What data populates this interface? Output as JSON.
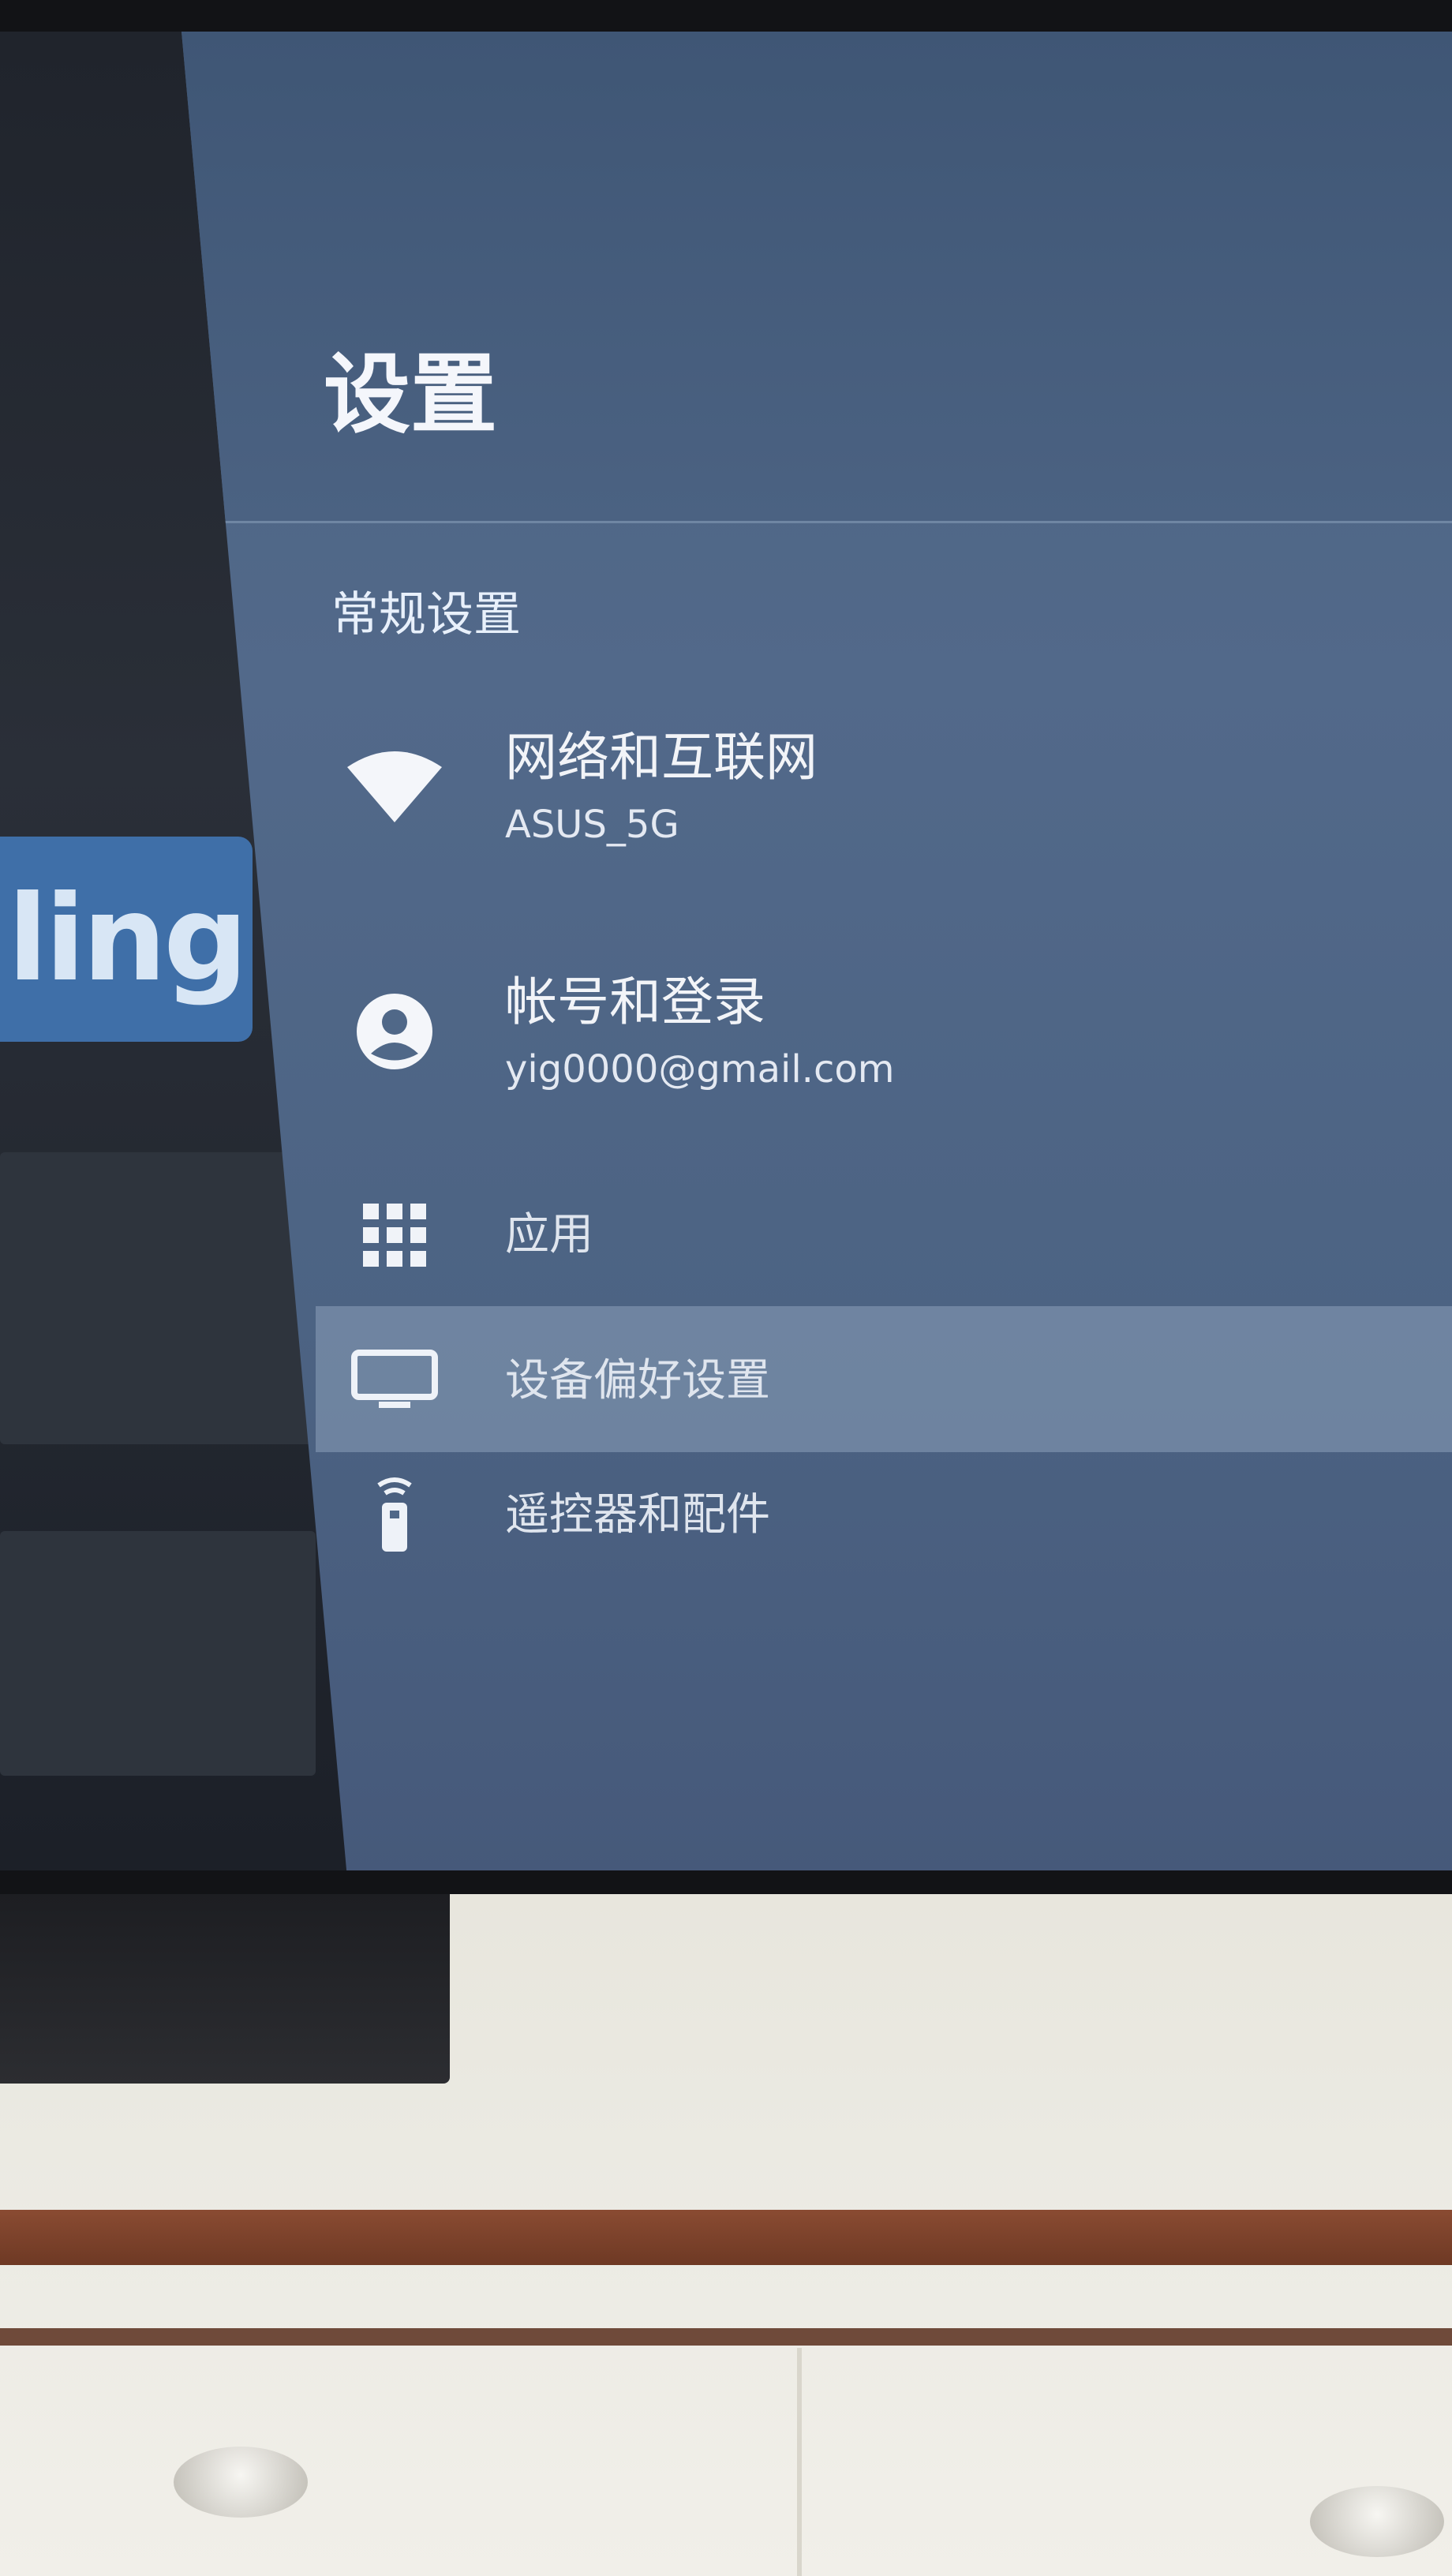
{
  "settings": {
    "title": "设置",
    "section": "常规设置",
    "items": [
      {
        "label": "网络和互联网",
        "sub": "ASUS_5G",
        "icon": "wifi-icon"
      },
      {
        "label": "帐号和登录",
        "sub": "yig0000@gmail.com",
        "icon": "account-circle-icon"
      },
      {
        "label": "应用",
        "icon": "apps-grid-icon"
      },
      {
        "label": "设备偏好设置",
        "icon": "tv-icon"
      },
      {
        "label": "遥控器和配件",
        "icon": "remote-icon"
      }
    ]
  },
  "background_app": {
    "logo_text": "ling"
  },
  "colors": {
    "panel": "#4c6383",
    "focus": "#8ca0b9",
    "text": "#f2f4f8"
  }
}
